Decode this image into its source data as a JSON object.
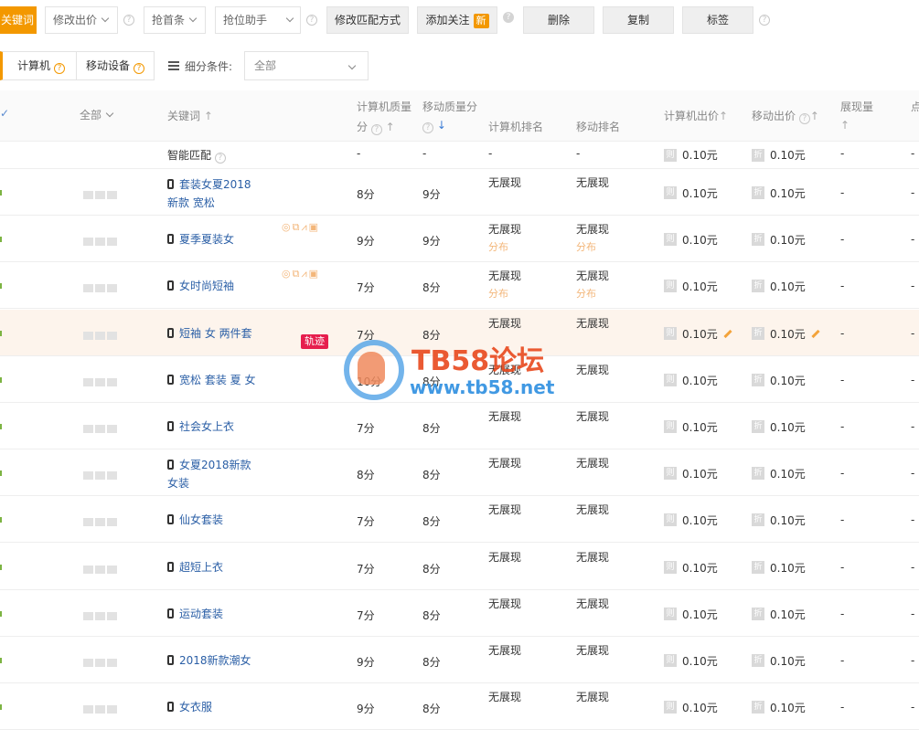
{
  "toolbar": {
    "keyword_tab": "关键词",
    "modify_bid": "修改出价",
    "grab_first": "抢首条",
    "rank_assistant": "抢位助手",
    "modify_match": "修改匹配方式",
    "add_follow": "添加关注",
    "new_badge": "新",
    "delete": "删除",
    "copy": "复制",
    "tags": "标签"
  },
  "filters": {
    "computer": "计算机",
    "mobile": "移动设备",
    "sub_condition": "细分条件:",
    "select_value": "全部"
  },
  "table": {
    "headers": {
      "all": "全部",
      "keyword": "关键词",
      "pc_quality": "计算机质量",
      "pc_quality_unit": "分",
      "mobile_quality": "移动质量分",
      "pc_rank": "计算机排名",
      "mobile_rank": "移动排名",
      "pc_bid": "计算机出价",
      "mobile_bid": "移动出价",
      "impressions": "展现量",
      "clicks": "点"
    },
    "smart_row": {
      "label": "智能匹配",
      "pc_quality": "-",
      "mobile_quality": "-",
      "pc_rank": "-",
      "mobile_rank": "-",
      "pc_bid": "0.10元",
      "mobile_bid": "0.10元",
      "impressions": "-",
      "clicks": "-"
    },
    "rows": [
      {
        "keyword": "套装女夏2018新款 宽松",
        "pc_q": "8分",
        "m_q": "9分",
        "pc_rank": "无展现",
        "m_rank": "无展现",
        "pc_dist": "",
        "m_dist": "",
        "pc_bid": "0.10元",
        "m_bid": "0.10元",
        "imp": "-",
        "clk": "-"
      },
      {
        "keyword": "夏季夏装女",
        "pc_q": "9分",
        "m_q": "9分",
        "pc_rank": "无展现",
        "m_rank": "无展现",
        "pc_dist": "分布",
        "m_dist": "分布",
        "pc_bid": "0.10元",
        "m_bid": "0.10元",
        "imp": "-",
        "clk": "-"
      },
      {
        "keyword": "女时尚短袖",
        "pc_q": "7分",
        "m_q": "8分",
        "pc_rank": "无展现",
        "m_rank": "无展现",
        "pc_dist": "分布",
        "m_dist": "分布",
        "pc_bid": "0.10元",
        "m_bid": "0.10元",
        "imp": "-",
        "clk": "-"
      },
      {
        "keyword": "短袖 女 两件套",
        "pc_q": "7分",
        "m_q": "8分",
        "pc_rank": "无展现",
        "m_rank": "无展现",
        "pc_dist": "",
        "m_dist": "",
        "pc_bid": "0.10元",
        "m_bid": "0.10元",
        "imp": "-",
        "clk": "-"
      },
      {
        "keyword": "宽松 套装 夏 女",
        "pc_q": "10分",
        "m_q": "8分",
        "pc_rank": "无展现",
        "m_rank": "无展现",
        "pc_dist": "",
        "m_dist": "",
        "pc_bid": "0.10元",
        "m_bid": "0.10元",
        "imp": "-",
        "clk": "-"
      },
      {
        "keyword": "社会女上衣",
        "pc_q": "7分",
        "m_q": "8分",
        "pc_rank": "无展现",
        "m_rank": "无展现",
        "pc_dist": "",
        "m_dist": "",
        "pc_bid": "0.10元",
        "m_bid": "0.10元",
        "imp": "-",
        "clk": "-"
      },
      {
        "keyword": "女夏2018新款女装",
        "pc_q": "8分",
        "m_q": "8分",
        "pc_rank": "无展现",
        "m_rank": "无展现",
        "pc_dist": "",
        "m_dist": "",
        "pc_bid": "0.10元",
        "m_bid": "0.10元",
        "imp": "-",
        "clk": "-"
      },
      {
        "keyword": "仙女套装",
        "pc_q": "7分",
        "m_q": "8分",
        "pc_rank": "无展现",
        "m_rank": "无展现",
        "pc_dist": "",
        "m_dist": "",
        "pc_bid": "0.10元",
        "m_bid": "0.10元",
        "imp": "-",
        "clk": "-"
      },
      {
        "keyword": "超短上衣",
        "pc_q": "7分",
        "m_q": "8分",
        "pc_rank": "无展现",
        "m_rank": "无展现",
        "pc_dist": "",
        "m_dist": "",
        "pc_bid": "0.10元",
        "m_bid": "0.10元",
        "imp": "-",
        "clk": "-"
      },
      {
        "keyword": "运动套装",
        "pc_q": "7分",
        "m_q": "8分",
        "pc_rank": "无展现",
        "m_rank": "无展现",
        "pc_dist": "",
        "m_dist": "",
        "pc_bid": "0.10元",
        "m_bid": "0.10元",
        "imp": "-",
        "clk": "-"
      },
      {
        "keyword": "2018新款潮女",
        "pc_q": "9分",
        "m_q": "8分",
        "pc_rank": "无展现",
        "m_rank": "无展现",
        "pc_dist": "",
        "m_dist": "",
        "pc_bid": "0.10元",
        "m_bid": "0.10元",
        "imp": "-",
        "clk": "-"
      },
      {
        "keyword": "女衣服",
        "pc_q": "9分",
        "m_q": "8分",
        "pc_rank": "无展现",
        "m_rank": "无展现",
        "pc_dist": "",
        "m_dist": "",
        "pc_bid": "0.10元",
        "m_bid": "0.10元",
        "imp": "-",
        "clk": "-"
      }
    ],
    "trail_badge": "轨迹",
    "pc_price_icon": "则",
    "mobile_price_icon": "折"
  },
  "watermark": {
    "title": "TB58论坛",
    "url": "www.tb58.net"
  }
}
